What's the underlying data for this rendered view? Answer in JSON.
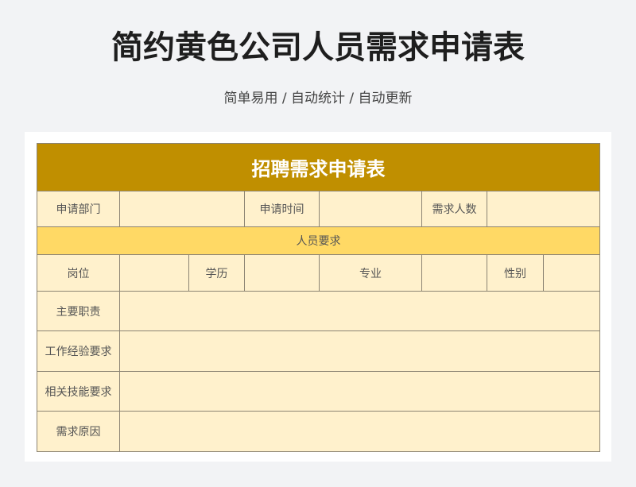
{
  "page": {
    "title": "简约黄色公司人员需求申请表",
    "subtitle": "简单易用 / 自动统计 / 自动更新"
  },
  "form": {
    "header": "招聘需求申请表",
    "row1": {
      "department_label": "申请部门",
      "department_value": "",
      "date_label": "申请时间",
      "date_value": "",
      "headcount_label": "需求人数",
      "headcount_value": ""
    },
    "section_label": "人员要求",
    "row2": {
      "position_label": "岗位",
      "position_value": "",
      "education_label": "学历",
      "education_value": "",
      "major_label": "专业",
      "major_value": "",
      "gender_label": "性别",
      "gender_value": ""
    },
    "duties_label": "主要职责",
    "duties_value": "",
    "experience_label": "工作经验要求",
    "experience_value": "",
    "skills_label": "相关技能要求",
    "skills_value": "",
    "reason_label": "需求原因",
    "reason_value": ""
  },
  "colors": {
    "header_bg": "#c08f00",
    "section_bg": "#ffd965",
    "cell_bg": "#fff1cc",
    "border": "#8c8473"
  }
}
